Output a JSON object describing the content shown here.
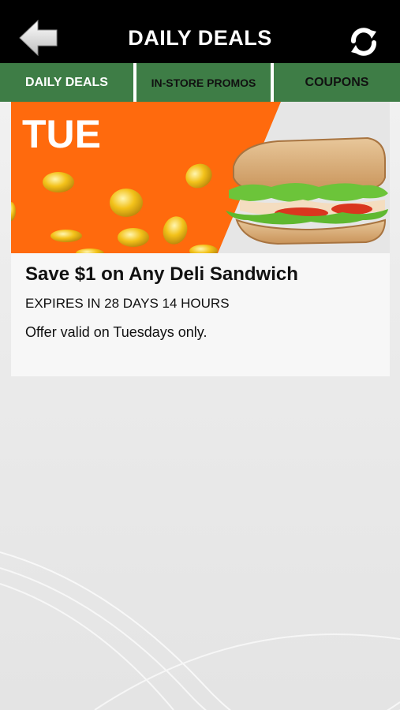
{
  "header": {
    "title": "DAILY DEALS",
    "back_icon": "back-arrow-icon",
    "refresh_icon": "refresh-icon"
  },
  "tabs": [
    {
      "label": "DAILY DEALS",
      "active": true
    },
    {
      "label": "IN-STORE PROMOS",
      "active": false
    },
    {
      "label": "COUPONS",
      "active": false
    }
  ],
  "deal": {
    "banner_day": "TUE",
    "title": "Save $1 on Any Deli Sandwich",
    "expires": "EXPIRES IN 28 DAYS 14 HOURS",
    "description": "Offer valid on Tuesdays only."
  },
  "colors": {
    "header_bg": "#000000",
    "tab_green": "#3e7d46",
    "banner_orange": "#ff6a0d",
    "coin_gold": "#f3c21a"
  }
}
